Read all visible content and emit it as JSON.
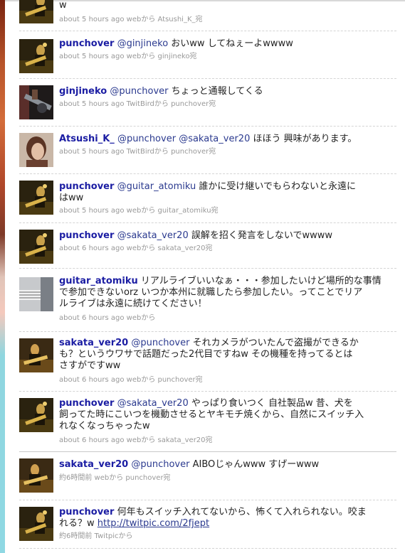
{
  "tweets": [
    {
      "id": "t0",
      "user": "",
      "text": "w",
      "meta": "about 5 hours ago webから Atsushi_K_宛",
      "avatar_icon": "guitarist-avatar-icon"
    },
    {
      "id": "t1",
      "user": "punchover",
      "mention": "@ginjineko",
      "text": "おいww してねぇーよwwww",
      "meta": "about 5 hours ago webから ginjineko宛",
      "avatar_icon": "guitarist-avatar-icon"
    },
    {
      "id": "t2",
      "user": "ginjineko",
      "mention": "@punchover",
      "text": "ちょっと通報してくる",
      "meta": "about 5 hours ago TwitBirdから punchover宛",
      "avatar_icon": "guitar-avatar-icon"
    },
    {
      "id": "t3",
      "user": "Atsushi_K_",
      "mention": "@punchover",
      "mention2": "@sakata_ver20",
      "text": "ほほう 興味があります。",
      "meta": "about 5 hours ago TwitBirdから punchover宛",
      "avatar_icon": "woman-avatar-icon"
    },
    {
      "id": "t4",
      "user": "punchover",
      "mention": "@guitar_atomiku",
      "text_line1": "誰かに受け継いでもらわないと永遠に",
      "text_line2": "はww",
      "meta": "about 5 hours ago webから guitar_atomiku宛",
      "avatar_icon": "guitarist-avatar-icon"
    },
    {
      "id": "t5",
      "user": "punchover",
      "mention": "@sakata_ver20",
      "text": "誤解を招く発言をしないでwwww",
      "meta": "about 6 hours ago webから sakata_ver20宛",
      "avatar_icon": "guitarist-avatar-icon"
    },
    {
      "id": "t6",
      "user": "guitar_atomiku",
      "text_line1": "リアルライブいいなぁ・・・参加したいけど場所的な事情",
      "text_line2": "で参加できないorz いつか本州に就職したら参加したい。ってことでリア",
      "text_line3": "ルライブは永遠に続けてください！",
      "meta": "about 6 hours ago webから",
      "avatar_icon": "guitar-closeup-avatar-icon"
    },
    {
      "id": "t7",
      "user": "sakata_ver20",
      "mention": "@punchover",
      "text_line1": "それカメラがついたんで盗撮ができるか",
      "text_line2": "も？というウワサで話題だった2代目ですねw その機種を持ってるとは",
      "text_line3": "さすがですww",
      "meta": "about 6 hours ago webから punchover宛",
      "avatar_icon": "guitarist-avatar-icon"
    },
    {
      "id": "t8",
      "user": "punchover",
      "mention": "@sakata_ver20",
      "text_line1": "やっぱり食いつく 自社製品w 昔、犬を",
      "text_line2": "飼ってた時にこいつを機動させるとヤキモチ焼くから、自然にスイッチ入",
      "text_line3": "れなくなっちゃったw",
      "meta": "about 6 hours ago webから sakata_ver20宛",
      "avatar_icon": "guitarist-avatar-icon"
    },
    {
      "id": "t9",
      "user": "sakata_ver20",
      "mention": "@punchover",
      "text": "AIBOじゃんwww すげーwww",
      "meta": "約6時間前 webから punchover宛",
      "avatar_icon": "guitarist-avatar-icon"
    },
    {
      "id": "t10",
      "user": "punchover",
      "text_line1": "何年もスイッチ入れてないから、怖くて入れられない。咬ま",
      "text_line2": "れる？w",
      "link": "http://twitpic.com/2fjept",
      "meta": "約6時間前 Twitpicから",
      "avatar_icon": "guitarist-avatar-icon"
    }
  ],
  "colors": {
    "username": "#1b1da3",
    "mention": "#2b3a8f",
    "meta": "#999999",
    "strip_top": "#b8542a",
    "strip_bottom": "#8fd8e3"
  }
}
